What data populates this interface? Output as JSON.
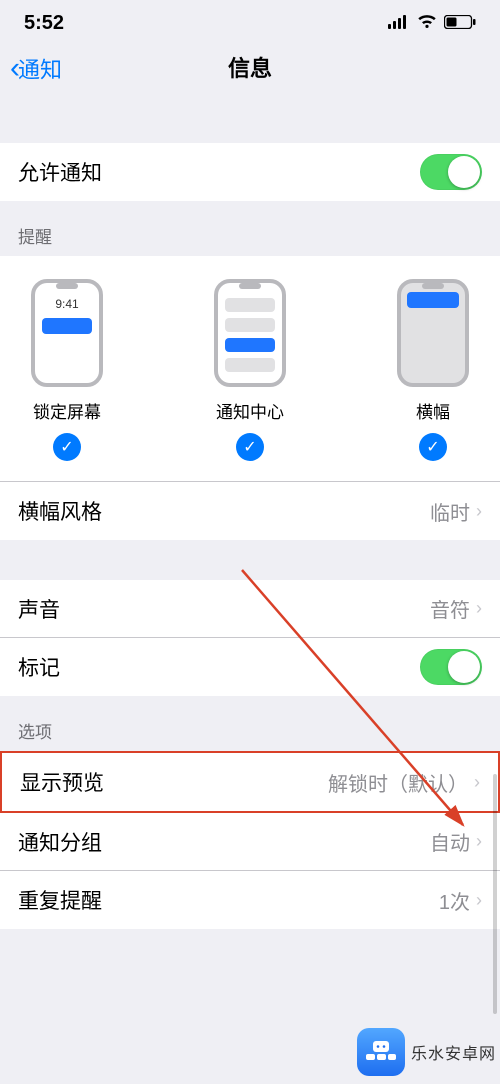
{
  "status": {
    "time": "5:52"
  },
  "nav": {
    "back": "通知",
    "title": "信息"
  },
  "allow": {
    "label": "允许通知",
    "on": true
  },
  "alerts": {
    "header": "提醒",
    "options": [
      {
        "label": "锁定屏幕",
        "time_in_preview": "9:41"
      },
      {
        "label": "通知中心"
      },
      {
        "label": "横幅"
      }
    ]
  },
  "banner_style": {
    "label": "横幅风格",
    "value": "临时"
  },
  "sounds": {
    "label": "声音",
    "value": "音符"
  },
  "badges": {
    "label": "标记",
    "on": true
  },
  "options_header": "选项",
  "show_previews": {
    "label": "显示预览",
    "value": "解锁时（默认）"
  },
  "grouping": {
    "label": "通知分组",
    "value": "自动"
  },
  "repeat": {
    "label": "重复提醒",
    "value": "1次"
  },
  "watermark": "乐水安卓网"
}
